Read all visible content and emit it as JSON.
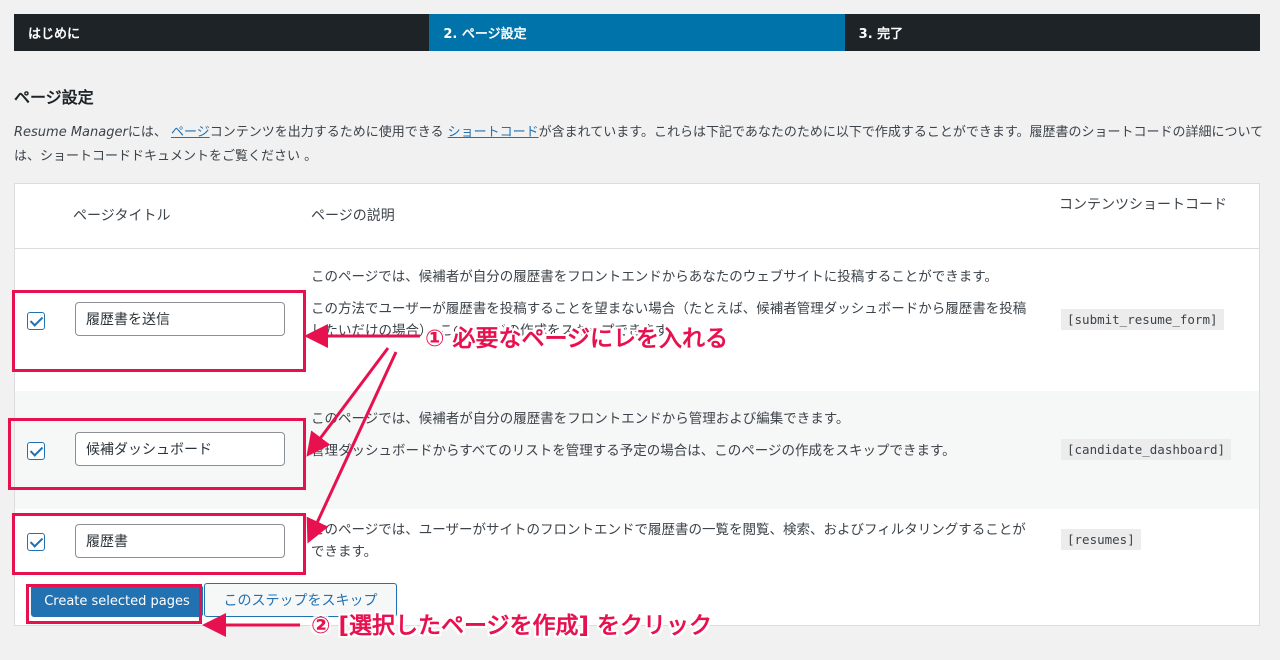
{
  "steps": [
    {
      "label": "はじめに",
      "active": false
    },
    {
      "label": "2. ページ設定",
      "active": true
    },
    {
      "label": "3. 完了",
      "active": false
    }
  ],
  "page_title": "ページ設定",
  "intro": {
    "product": "Resume Manager",
    "t1": "には、",
    "link_pages": "ページ",
    "t2": "コンテンツを出力するために使用できる",
    "link_shortcodes": "ショートコード",
    "t3": "が含まれています。これらは下記であなたのために以下で作成することができます。履歴書のショートコードの詳細については、ショートコードドキュメントをご覧ください 。"
  },
  "table": {
    "headers": {
      "title": "ページタイトル",
      "description": "ページの説明",
      "shortcode": "コンテンツショートコード"
    },
    "rows": [
      {
        "checked": true,
        "title": "履歴書を送信",
        "desc1": "このページでは、候補者が自分の履歴書をフロントエンドからあなたのウェブサイトに投稿することができます。",
        "desc2": "この方法でユーザーが履歴書を投稿することを望まない場合（たとえば、候補者管理ダッシュボードから履歴書を投稿したいだけの場合）、このページの作成をスキップできます。",
        "shortcode": "[submit_resume_form]"
      },
      {
        "checked": true,
        "title": "候補ダッシュボード",
        "desc1": "このページでは、候補者が自分の履歴書をフロントエンドから管理および編集できます。",
        "desc2": "管理ダッシュボードからすべてのリストを管理する予定の場合は、このページの作成をスキップできます。",
        "shortcode": "[candidate_dashboard]"
      },
      {
        "checked": true,
        "title": "履歴書",
        "desc1": "このページでは、ユーザーがサイトのフロントエンドで履歴書の一覧を閲覧、検索、およびフィルタリングすることができます。",
        "desc2": "",
        "shortcode": "[resumes]"
      }
    ]
  },
  "buttons": {
    "create": "Create selected pages",
    "skip": "このステップをスキップ"
  },
  "annotations": {
    "note1": "① 必要なページにレを入れる",
    "note2": "② [選択したページを作成] をクリック",
    "color": "#e8114f"
  },
  "colors": {
    "accent": "#0073aa",
    "step_bg": "#1d2327",
    "link": "#2271b1"
  }
}
